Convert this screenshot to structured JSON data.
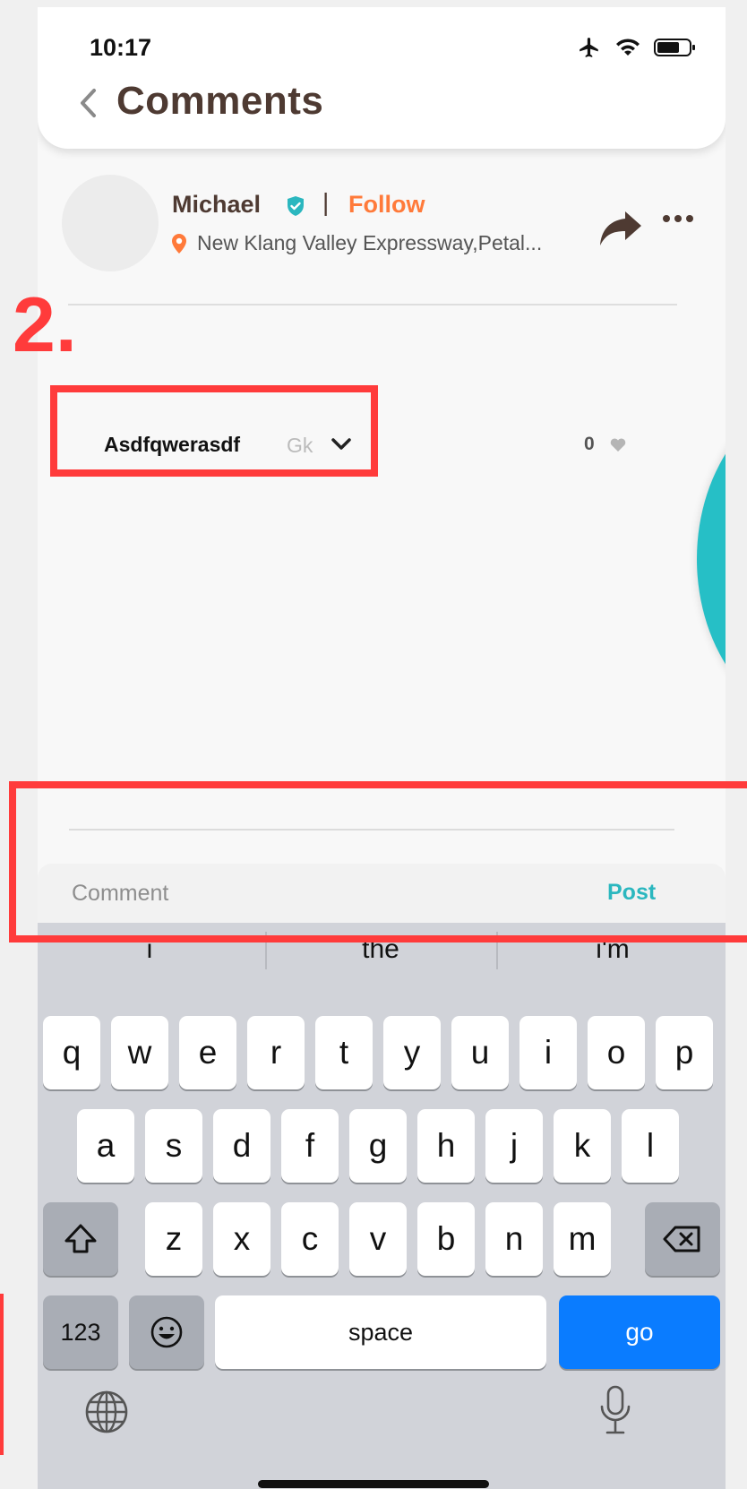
{
  "status_bar": {
    "time": "10:17"
  },
  "header": {
    "title": "Comments"
  },
  "post": {
    "author": "Michael",
    "separator": "|",
    "follow_label": "Follow",
    "location": "New Klang Valley Expressway,Petal..."
  },
  "annotation": {
    "number": "2."
  },
  "comment": {
    "username": "Asdfqwerasdf",
    "text": "Gk",
    "like_count": "0"
  },
  "comment_bar": {
    "placeholder": "Comment",
    "post_label": "Post"
  },
  "keyboard": {
    "suggestions": [
      "i",
      "the",
      "i'm"
    ],
    "row1": [
      "q",
      "w",
      "e",
      "r",
      "t",
      "y",
      "u",
      "i",
      "o",
      "p"
    ],
    "row2": [
      "a",
      "s",
      "d",
      "f",
      "g",
      "h",
      "j",
      "k",
      "l"
    ],
    "row3": [
      "z",
      "x",
      "c",
      "v",
      "b",
      "n",
      "m"
    ],
    "numbers_label": "123",
    "space_label": "space",
    "go_label": "go"
  },
  "colors": {
    "accent_orange": "#ff7a3a",
    "accent_teal": "#2bb7bf",
    "title_brown": "#4e3a32",
    "annotation_red": "#ff3b3b",
    "keyboard_go_blue": "#0a7cff"
  }
}
